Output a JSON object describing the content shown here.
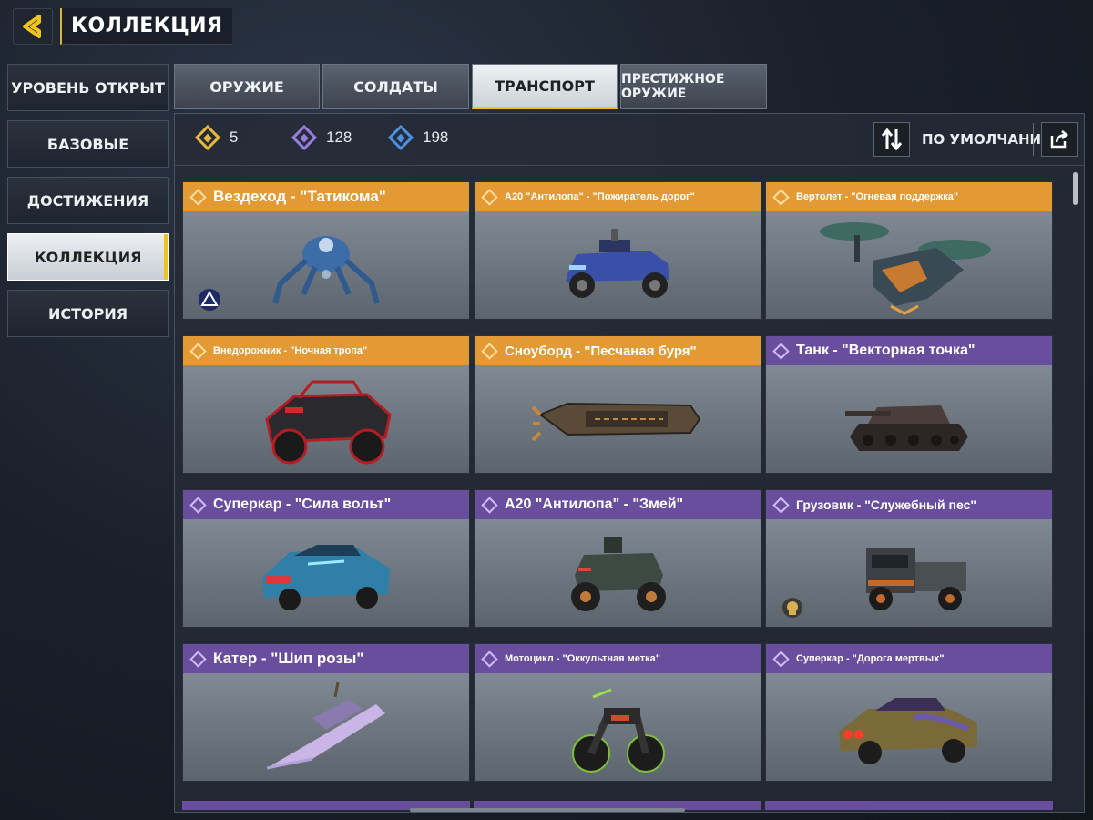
{
  "header": {
    "title": "КОЛЛЕКЦИЯ"
  },
  "sidebar": {
    "items": [
      {
        "label": "УРОВЕНЬ ОТКРЫТ"
      },
      {
        "label": "БАЗОВЫЕ"
      },
      {
        "label": "ДОСТИЖЕНИЯ"
      },
      {
        "label": "КОЛЛЕКЦИЯ",
        "active": true
      },
      {
        "label": "ИСТОРИЯ"
      }
    ]
  },
  "tabs": [
    {
      "label": "ОРУЖИЕ"
    },
    {
      "label": "СОЛДАТЫ"
    },
    {
      "label": "ТРАНСПОРТ",
      "active": true
    },
    {
      "label": "ПРЕСТИЖНОЕ ОРУЖИЕ"
    }
  ],
  "counters": [
    {
      "value": "5",
      "color": "#e8b83a",
      "icon": "legendary-diamond-icon"
    },
    {
      "value": "128",
      "color": "#9a7be0",
      "icon": "epic-diamond-icon"
    },
    {
      "value": "198",
      "color": "#4d8fe0",
      "icon": "rare-diamond-icon"
    }
  ],
  "sort": {
    "label": "ПО УМОЛЧАНИЮ"
  },
  "colors": {
    "accent": "#f0c419",
    "legendary": "#e39a35",
    "epic": "#6a4e9e"
  },
  "cards": [
    {
      "title": "Вездеход - \"Татикома\"",
      "rarity": "legendary"
    },
    {
      "title": "A20 \"Антилопа\" - \"Пожиратель дорог\"",
      "rarity": "legendary"
    },
    {
      "title": "Вертолет - \"Огневая поддержка\"",
      "rarity": "legendary"
    },
    {
      "title": "Внедорожник - \"Ночная тропа\"",
      "rarity": "legendary"
    },
    {
      "title": "Сноуборд - \"Песчаная буря\"",
      "rarity": "legendary"
    },
    {
      "title": "Танк - \"Векторная точка\"",
      "rarity": "epic"
    },
    {
      "title": "Суперкар - \"Сила вольт\"",
      "rarity": "epic"
    },
    {
      "title": "A20 \"Антилопа\" - \"Змей\"",
      "rarity": "epic"
    },
    {
      "title": "Грузовик - \"Служебный пес\"",
      "rarity": "epic"
    },
    {
      "title": "Катер - \"Шип розы\"",
      "rarity": "epic"
    },
    {
      "title": "Мотоцикл - \"Оккультная метка\"",
      "rarity": "epic"
    },
    {
      "title": "Суперкар - \"Дорога мертвых\"",
      "rarity": "epic"
    }
  ]
}
